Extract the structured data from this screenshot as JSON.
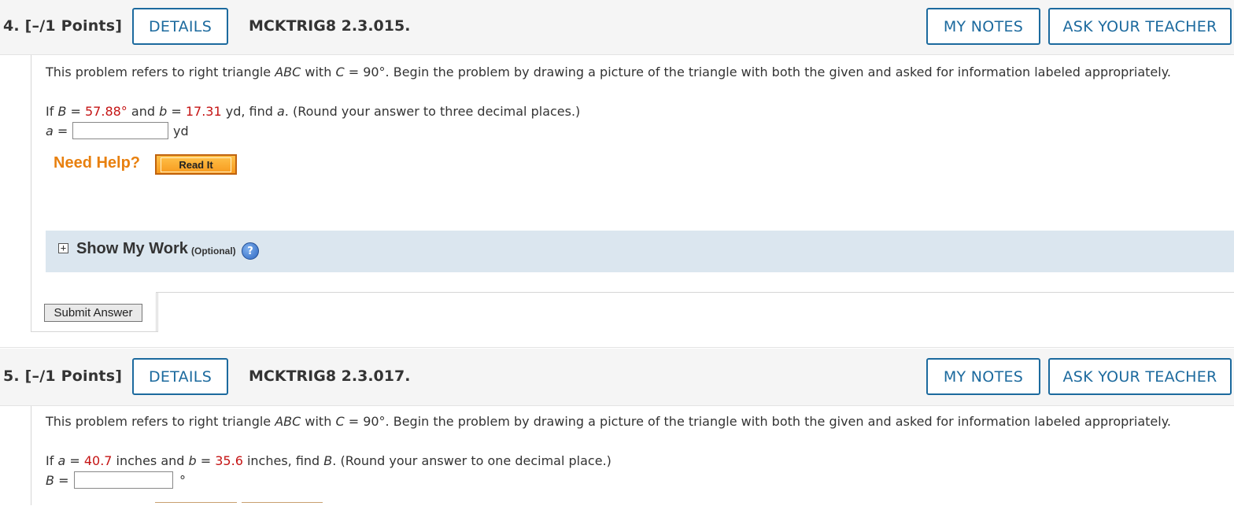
{
  "q4": {
    "number": "4.  [–/1 Points]",
    "details": "DETAILS",
    "code": "MCKTRIG8 2.3.015.",
    "my_notes": "MY NOTES",
    "ask_teacher": "ASK YOUR TEACHER",
    "intro_pre": "This problem refers to right triangle ",
    "intro_abc": "ABC",
    "intro_mid": " with  ",
    "intro_c": "C",
    "intro_post": " = 90°.  Begin the problem by drawing a picture of the triangle with both the given and asked for information labeled appropriately.",
    "given_pre": "If  ",
    "given_var1": "B",
    "given_eq1": " = ",
    "given_val1": "57.88°",
    "given_and": " and ",
    "given_var2": "b",
    "given_eq2": " = ",
    "given_val2": "17.31",
    "given_post": " yd,  find ",
    "given_find": "a",
    "given_round": ". (Round your answer to three decimal places.)",
    "ans_label": "a =",
    "ans_value": "",
    "ans_unit": "yd",
    "need_help": "Need Help?",
    "read_it": "Read It",
    "show_work": "Show My Work",
    "optional": "(Optional)",
    "help_glyph": "?",
    "plus_glyph": "+",
    "submit": "Submit Answer"
  },
  "q5": {
    "number": "5.  [–/1 Points]",
    "details": "DETAILS",
    "code": "MCKTRIG8 2.3.017.",
    "my_notes": "MY NOTES",
    "ask_teacher": "ASK YOUR TEACHER",
    "intro_pre": "This problem refers to right triangle ",
    "intro_abc": "ABC",
    "intro_mid": " with  ",
    "intro_c": "C",
    "intro_post": " = 90°.  Begin the problem by drawing a picture of the triangle with both the given and asked for information labeled appropriately.",
    "given_pre": "If  ",
    "given_var1": "a",
    "given_eq1": " = ",
    "given_val1": "40.7",
    "given_mid": " inches and ",
    "given_var2": "b",
    "given_eq2": " = ",
    "given_val2": "35.6",
    "given_post": " inches,  find ",
    "given_find": "B",
    "given_round": ". (Round your answer to one decimal place.)",
    "ans_label": "B =",
    "ans_value": "",
    "ans_unit": "°"
  },
  "colors": {
    "accent": "#1c6a9e",
    "given_value": "#c51414",
    "need_help": "#e8800f",
    "show_work_bg": "#dbe6ef"
  }
}
